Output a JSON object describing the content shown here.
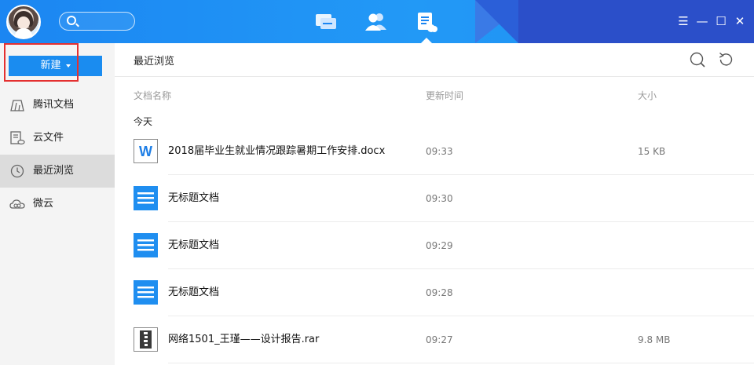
{
  "colors": {
    "accent": "#1a8cf0",
    "titlebar": "#1b86f2",
    "highlight": "#e43030"
  },
  "titlebar": {
    "nav": [
      {
        "icon": "chat-bubbles-icon",
        "active": false
      },
      {
        "icon": "contacts-icon",
        "active": false
      },
      {
        "icon": "documents-cloud-icon",
        "active": true
      }
    ],
    "controls": {
      "menu": "☰",
      "minimize": "—",
      "maximize": "☐",
      "close": "✕"
    }
  },
  "sidebar": {
    "new_button": "新建",
    "items": [
      {
        "label": "腾讯文档",
        "icon": "tencent-docs-icon",
        "selected": false,
        "highlighted": true
      },
      {
        "label": "云文件",
        "icon": "cloud-file-icon",
        "selected": false
      },
      {
        "label": "最近浏览",
        "icon": "clock-icon",
        "selected": true
      },
      {
        "label": "微云",
        "icon": "weiyun-cloud-icon",
        "selected": false
      }
    ]
  },
  "main": {
    "title": "最近浏览",
    "columns": {
      "name": "文档名称",
      "time": "更新时间",
      "size": "大小"
    },
    "group": "今天",
    "files": [
      {
        "name": "2018届毕业生就业情况跟踪暑期工作安排.docx",
        "time": "09:33",
        "size": "15 KB",
        "icon": "word-doc-icon"
      },
      {
        "name": "无标题文档",
        "time": "09:30",
        "size": "",
        "icon": "online-doc-icon"
      },
      {
        "name": "无标题文档",
        "time": "09:29",
        "size": "",
        "icon": "online-doc-icon"
      },
      {
        "name": "无标题文档",
        "time": "09:28",
        "size": "",
        "icon": "online-doc-icon"
      },
      {
        "name": "网络1501_王瑾——设计报告.rar",
        "time": "09:27",
        "size": "9.8 MB",
        "icon": "rar-archive-icon"
      }
    ]
  }
}
